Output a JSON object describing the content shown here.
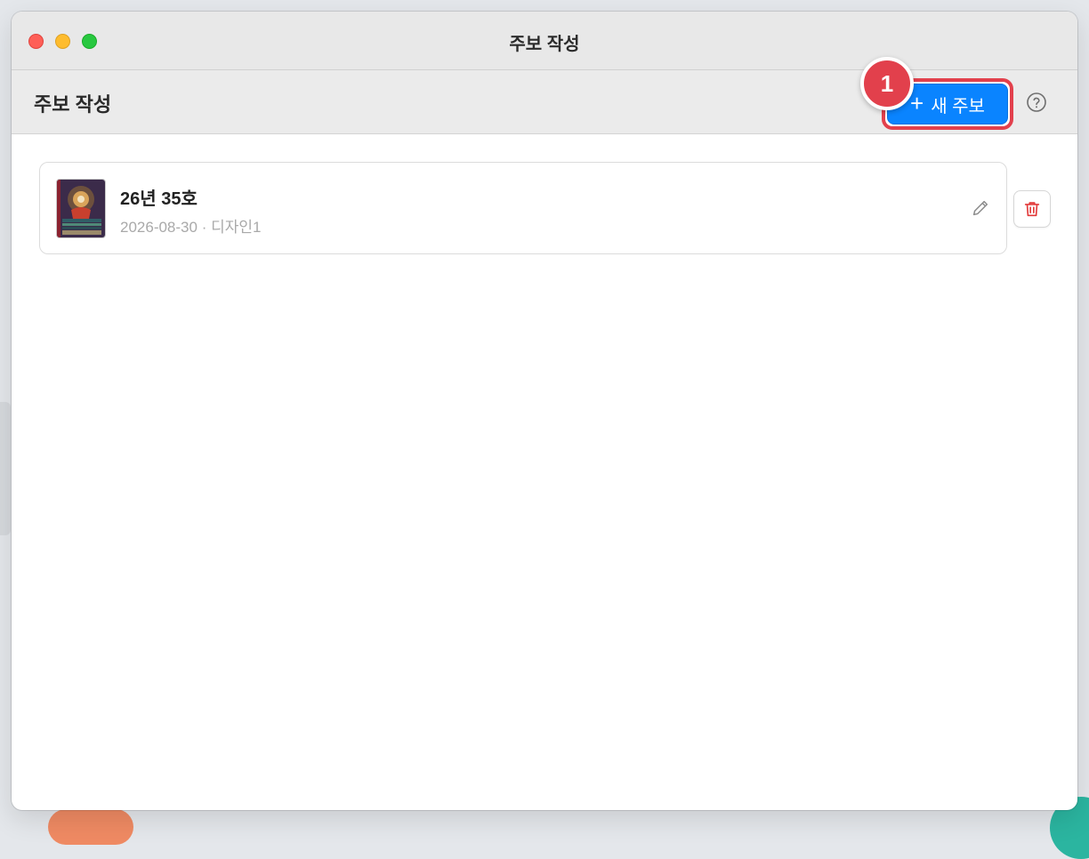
{
  "window": {
    "title": "주보 작성"
  },
  "toolbar": {
    "title": "주보 작성",
    "new_button_label": "새 주보",
    "new_button_icon": "+",
    "step_badge": "1",
    "help_icon": "question-circle-icon"
  },
  "bulletins": [
    {
      "title": "26년 35호",
      "date": "2026-08-30",
      "separator": "·",
      "design": "디자인1"
    }
  ],
  "colors": {
    "accent": "#0a84ff",
    "highlight": "#e2404c",
    "delete": "#e23a3a",
    "muted_text": "#a9a9a9"
  }
}
